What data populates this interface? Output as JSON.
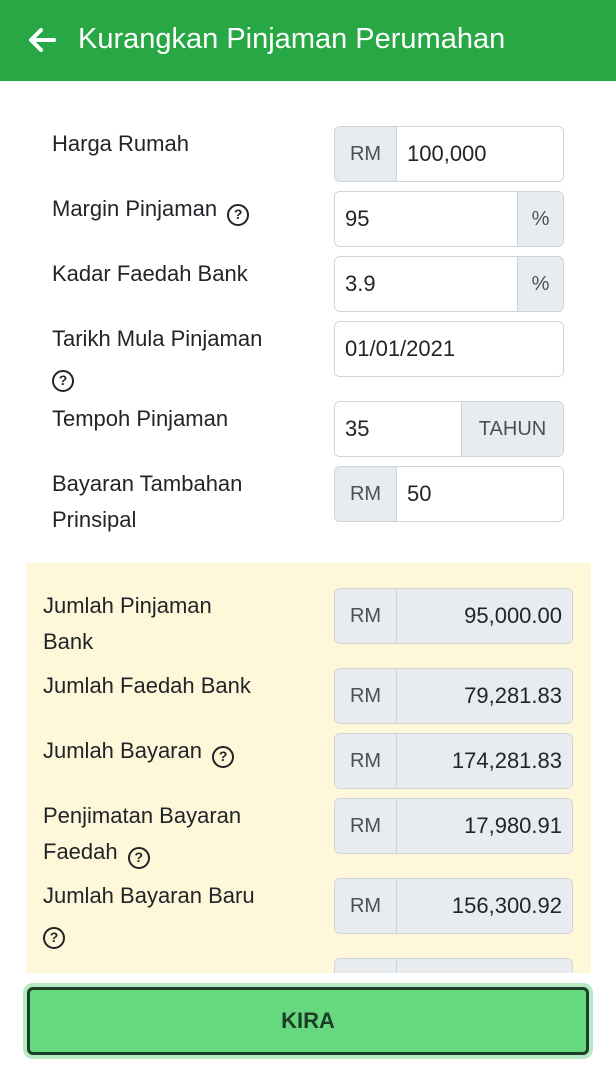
{
  "header": {
    "title": "Kurangkan Pinjaman Perumahan",
    "background": "#27a844"
  },
  "form": {
    "harga_rumah": {
      "label": "Harga Rumah",
      "prefix": "RM",
      "value": "100,000"
    },
    "margin_pinjaman": {
      "label": "Margin Pinjaman",
      "value": "95",
      "suffix": "%"
    },
    "kadar_faedah": {
      "label": "Kadar Faedah Bank",
      "value": "3.9",
      "suffix": "%"
    },
    "tarikh_mula": {
      "label": "Tarikh Mula Pinjaman",
      "value": "01/01/2021"
    },
    "tempoh": {
      "label": "Tempoh Pinjaman",
      "value": "35",
      "suffix": "TAHUN"
    },
    "bayaran_tambahan": {
      "label_line1": "Bayaran Tambahan",
      "label_line2": "Prinsipal",
      "prefix": "RM",
      "value": "50"
    }
  },
  "results": {
    "background": "#fff7d9",
    "jumlah_pinjaman": {
      "label_line1": "Jumlah Pinjaman",
      "label_line2": "Bank",
      "prefix": "RM",
      "value": "95,000.00"
    },
    "jumlah_faedah": {
      "label": "Jumlah Faedah Bank",
      "prefix": "RM",
      "value": "79,281.83"
    },
    "jumlah_bayaran": {
      "label": "Jumlah Bayaran",
      "prefix": "RM",
      "value": "174,281.83"
    },
    "penjimatan": {
      "label_line1": "Penjimatan Bayaran",
      "label_line2": "Faedah",
      "prefix": "RM",
      "value": "17,980.91"
    },
    "jumlah_baru": {
      "label": "Jumlah Bayaran Baru",
      "prefix": "RM",
      "value": "156,300.92"
    }
  },
  "footer": {
    "kira_label": "KIRA",
    "button_color": "#66d97e"
  },
  "icons": {
    "help": "?",
    "back": "arrow-left-icon"
  }
}
